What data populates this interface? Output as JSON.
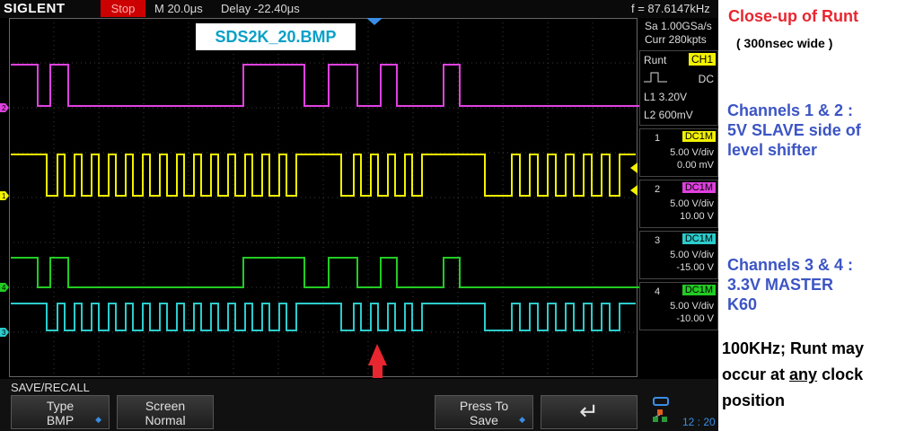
{
  "topbar": {
    "brand": "SIGLENT",
    "run_state": "Stop",
    "timebase": "M 20.0μs",
    "delay": "Delay -22.40μs",
    "frequency": "f = 87.6147kHz"
  },
  "screen_label": "SDS2K_20.BMP",
  "acquisition": {
    "sample_rate": "Sa 1.00GSa/s",
    "memory": "Curr 280kpts"
  },
  "trigger": {
    "type": "Runt",
    "source": "CH1",
    "coupling": "DC",
    "l1": "L1  3.20V",
    "l2": "L2  600mV"
  },
  "channels": [
    {
      "num": "1",
      "coupling": "DC1M",
      "scale": "5.00 V/div",
      "offset": "0.00 mV",
      "color": "#f2f200"
    },
    {
      "num": "2",
      "coupling": "DC1M",
      "scale": "5.00 V/div",
      "offset": "10.00 V",
      "color": "#e040e0"
    },
    {
      "num": "3",
      "coupling": "DC1M",
      "scale": "5.00 V/div",
      "offset": "-15.00 V",
      "color": "#2ccccc"
    },
    {
      "num": "4",
      "coupling": "DC1M",
      "scale": "5.00 V/div",
      "offset": "-10.00 V",
      "color": "#22cc22"
    }
  ],
  "markers": [
    "2",
    "1",
    "4",
    "3"
  ],
  "softkeys": {
    "menu_title": "SAVE/RECALL",
    "type": {
      "line1": "Type",
      "line2": "BMP"
    },
    "screen": {
      "line1": "Screen",
      "line2": "Normal"
    },
    "press": {
      "line1": "Press To",
      "line2": "Save"
    },
    "back": "↵"
  },
  "clock": "12 : 20",
  "annotations": {
    "title": "Close-up of Runt",
    "subtitle": "( 300nsec wide )",
    "ch12_line1": "Channels 1 & 2 :",
    "ch12_line2": "5V SLAVE side of",
    "ch12_line3": "level shifter",
    "ch34_line1": "Channels 3 & 4 :",
    "ch34_line2": "3.3V MASTER",
    "ch34_line3": "K60",
    "note_line1": "100KHz; Runt may",
    "note_line2a": "occur at ",
    "note_line2b": "any",
    "note_line2c": " clock",
    "note_line3": "position"
  },
  "colors": {
    "arrow": "#e8262f",
    "trigger_marker": "#3a8ee6"
  }
}
